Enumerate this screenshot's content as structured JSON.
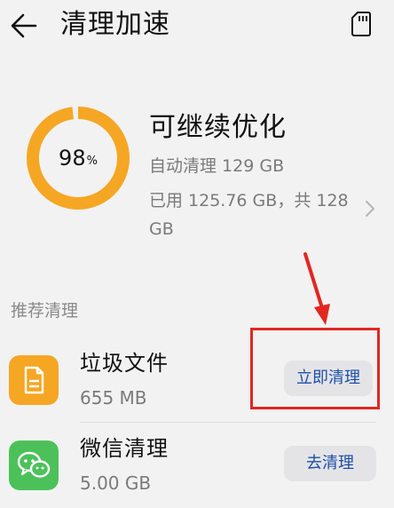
{
  "app_bar": {
    "title": "清理加速",
    "back_icon": "arrow-left-icon",
    "sd_icon": "sd-card-icon"
  },
  "summary": {
    "percent_value": "98",
    "percent_symbol": "%",
    "percent_fraction": 0.98,
    "headline": "可继续优化",
    "auto_clean": "自动清理 129 GB",
    "used_storage": "已用 125.76 GB，共 128 GB",
    "ring_color": "#f5a623",
    "chevron_icon": "chevron-right-icon"
  },
  "recommend": {
    "section_title": "推荐清理",
    "items": [
      {
        "name": "垃圾文件",
        "size": "655 MB",
        "action": "立即清理",
        "icon": "file-icon",
        "icon_color": "#f5a623"
      },
      {
        "name": "微信清理",
        "size": "5.00 GB",
        "action": "去清理",
        "icon": "wechat-icon",
        "icon_color": "#4cc15a"
      }
    ]
  },
  "annotation": {
    "color": "#e32620"
  }
}
